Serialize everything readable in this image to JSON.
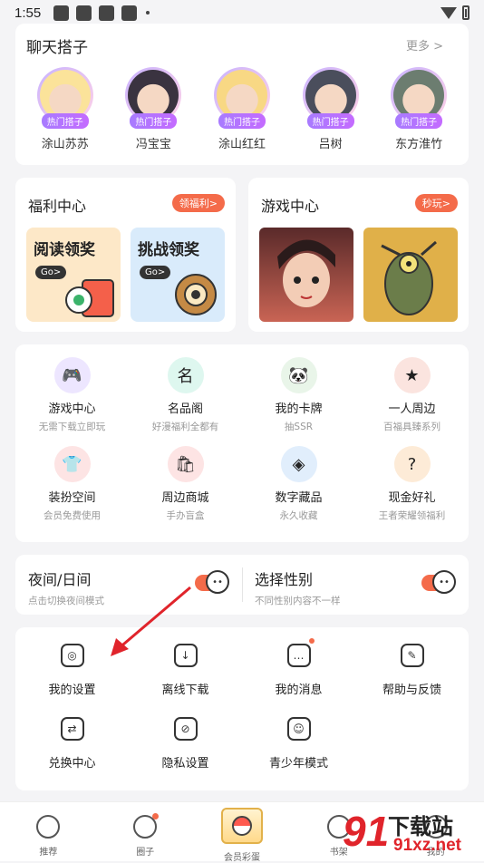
{
  "status_bar": {
    "time": "1:55"
  },
  "chat_partners": {
    "title": "聊天搭子",
    "more": "更多 >",
    "badge": "热门搭子",
    "items": [
      {
        "name": "涂山苏苏",
        "color": "#fbe39a"
      },
      {
        "name": "冯宝宝",
        "color": "#3a3340"
      },
      {
        "name": "涂山红红",
        "color": "#f8d884"
      },
      {
        "name": "吕树",
        "color": "#4a4e5c"
      },
      {
        "name": "东方淮竹",
        "color": "#6c7d70"
      }
    ]
  },
  "welfare": {
    "title": "福利中心",
    "pill": "领福利>",
    "promos": [
      {
        "title": "阅读领奖",
        "go": "Go>",
        "bg": "#fde8c8"
      },
      {
        "title": "挑战领奖",
        "go": "Go>",
        "bg": "#d9ebfb"
      }
    ]
  },
  "games": {
    "title": "游戏中心",
    "pill": "秒玩>",
    "items": [
      {
        "color": "#a44d4a"
      },
      {
        "color": "#d8a43a"
      }
    ]
  },
  "features": [
    {
      "label": "游戏中心",
      "sub": "无需下载立即玩",
      "icon": "gamepad-icon",
      "color": "#ede6ff",
      "glyph": "🎮"
    },
    {
      "label": "名品阁",
      "sub": "好漫福利全都有",
      "icon": "tag-icon",
      "color": "#def7ef",
      "glyph": "名"
    },
    {
      "label": "我的卡牌",
      "sub": "抽SSR",
      "icon": "panda-card-icon",
      "color": "#e9f5e9",
      "glyph": "🐼"
    },
    {
      "label": "一人周边",
      "sub": "百福具臻系列",
      "icon": "merch-icon",
      "color": "#fbe4df",
      "glyph": "★"
    },
    {
      "label": "装扮空间",
      "sub": "会员免费使用",
      "icon": "tshirt-icon",
      "color": "#fde4e4",
      "glyph": "👕"
    },
    {
      "label": "周边商城",
      "sub": "手办盲盒",
      "icon": "shop-icon",
      "color": "#fde4e4",
      "glyph": "🛍"
    },
    {
      "label": "数字藏品",
      "sub": "永久收藏",
      "icon": "cube-icon",
      "color": "#e1eefc",
      "glyph": "◈"
    },
    {
      "label": "现金好礼",
      "sub": "王者荣耀领福利",
      "icon": "gift-question-icon",
      "color": "#fdebd7",
      "glyph": "?"
    }
  ],
  "toggles": [
    {
      "title": "夜间/日间",
      "sub": "点击切换夜间模式"
    },
    {
      "title": "选择性别",
      "sub": "不同性别内容不一样"
    }
  ],
  "tools": [
    {
      "label": "我的设置",
      "icon": "settings-icon",
      "glyph": "◎",
      "dot": false
    },
    {
      "label": "离线下载",
      "icon": "download-icon",
      "glyph": "↓",
      "dot": false
    },
    {
      "label": "我的消息",
      "icon": "message-icon",
      "glyph": "…",
      "dot": true
    },
    {
      "label": "帮助与反馈",
      "icon": "feedback-icon",
      "glyph": "✎",
      "dot": false
    },
    {
      "label": "兑换中心",
      "icon": "exchange-icon",
      "glyph": "⇄",
      "dot": false
    },
    {
      "label": "隐私设置",
      "icon": "privacy-icon",
      "glyph": "⊘",
      "dot": false
    },
    {
      "label": "青少年模式",
      "icon": "youth-mode-icon",
      "glyph": "☺",
      "dot": false
    }
  ],
  "bottom_nav": [
    {
      "label": "推荐",
      "icon": "star-icon"
    },
    {
      "label": "圈子",
      "icon": "circle-icon"
    },
    {
      "label": "会员彩蛋",
      "icon": "vip-egg-icon"
    },
    {
      "label": "书架",
      "icon": "bookshelf-icon"
    },
    {
      "label": "我的",
      "icon": "profile-icon"
    }
  ],
  "watermark": {
    "big": "91",
    "line1": "下载站",
    "line2": "91xz.net"
  },
  "colors": {
    "accent": "#f46b4a",
    "badge": "#b07bff"
  }
}
